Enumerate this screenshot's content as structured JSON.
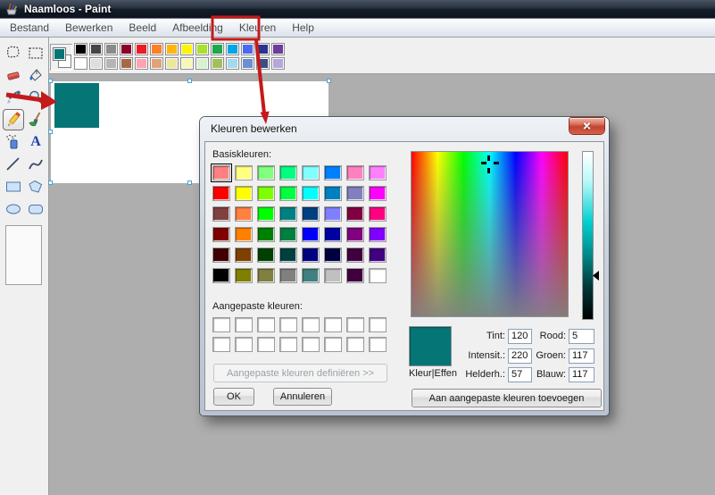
{
  "window": {
    "title": "Naamloos - Paint"
  },
  "menu": {
    "items": [
      {
        "label": "Bestand"
      },
      {
        "label": "Bewerken"
      },
      {
        "label": "Beeld"
      },
      {
        "label": "Afbeelding"
      },
      {
        "label": "Kleuren"
      },
      {
        "label": "Help"
      }
    ],
    "highlighted": "Kleuren"
  },
  "toolbar": {
    "foreground_color": "#057575",
    "background_color": "#ffffff",
    "palette_row1": [
      "#000000",
      "#464646",
      "#8a8a8a",
      "#8b0029",
      "#eb1d24",
      "#ff7f27",
      "#ffb70f",
      "#fdf400",
      "#a8e229",
      "#1ea849",
      "#00a5e6",
      "#4d68f0",
      "#2b3290",
      "#6f3b9c"
    ],
    "palette_row2": [
      "#ffffff",
      "#dedede",
      "#b5b5b5",
      "#a56a43",
      "#ffa3b1",
      "#e2a279",
      "#ece79a",
      "#f9f7b8",
      "#d6f2ce",
      "#a0c05a",
      "#a5d8ee",
      "#6d8fd1",
      "#3c4f84",
      "#b5a7dd"
    ]
  },
  "tools": {
    "names": [
      "free-form-select",
      "rectangular-select",
      "eraser",
      "fill-with-color",
      "color-picker",
      "magnifier",
      "pencil",
      "brush",
      "airbrush",
      "text",
      "line",
      "curve",
      "rectangle",
      "polygon",
      "ellipse",
      "rounded-rectangle"
    ],
    "selected": "pencil",
    "text_glyph": "A"
  },
  "canvas": {
    "shape_color": "#057575"
  },
  "dialog": {
    "title": "Kleuren bewerken",
    "basic_colors_label": "Basiskleuren:",
    "basic_colors": [
      "#ff8080",
      "#ffff80",
      "#80ff80",
      "#00ff80",
      "#80ffff",
      "#0080ff",
      "#ff80c0",
      "#ff80ff",
      "#ff0000",
      "#ffff00",
      "#80ff00",
      "#00ff40",
      "#00ffff",
      "#0080c0",
      "#8080c0",
      "#ff00ff",
      "#804040",
      "#ff8040",
      "#00ff00",
      "#008080",
      "#004080",
      "#8080ff",
      "#800040",
      "#ff0080",
      "#800000",
      "#ff8000",
      "#008000",
      "#008040",
      "#0000ff",
      "#0000a0",
      "#800080",
      "#8000ff",
      "#400000",
      "#804000",
      "#004000",
      "#004040",
      "#000080",
      "#000040",
      "#400040",
      "#400080",
      "#000000",
      "#808000",
      "#808040",
      "#808080",
      "#408080",
      "#c0c0c0",
      "#400040",
      "#ffffff"
    ],
    "selected_basic_index": 0,
    "custom_colors_label": "Aangepaste kleuren:",
    "custom_colors": [
      "#ffffff",
      "#ffffff",
      "#ffffff",
      "#ffffff",
      "#ffffff",
      "#ffffff",
      "#ffffff",
      "#ffffff",
      "#ffffff",
      "#ffffff",
      "#ffffff",
      "#ffffff",
      "#ffffff",
      "#ffffff",
      "#ffffff",
      "#ffffff"
    ],
    "define_button_label": "Aangepaste kleuren definiëren >>",
    "ok_label": "OK",
    "cancel_label": "Annuleren",
    "add_button_label": "Aan aangepaste kleuren toevoegen",
    "color_solid_label": "Kleur|Effen",
    "preview_color": "#057575",
    "fields": [
      {
        "label": "Tint:",
        "value": "120"
      },
      {
        "label": "Rood:",
        "value": "5"
      },
      {
        "label": "Intensit.:",
        "value": "220"
      },
      {
        "label": "Groen:",
        "value": "117"
      },
      {
        "label": "Helderh.:",
        "value": "57"
      },
      {
        "label": "Blauw:",
        "value": "117"
      }
    ]
  },
  "annotations": {
    "color": "#c51a1a"
  }
}
